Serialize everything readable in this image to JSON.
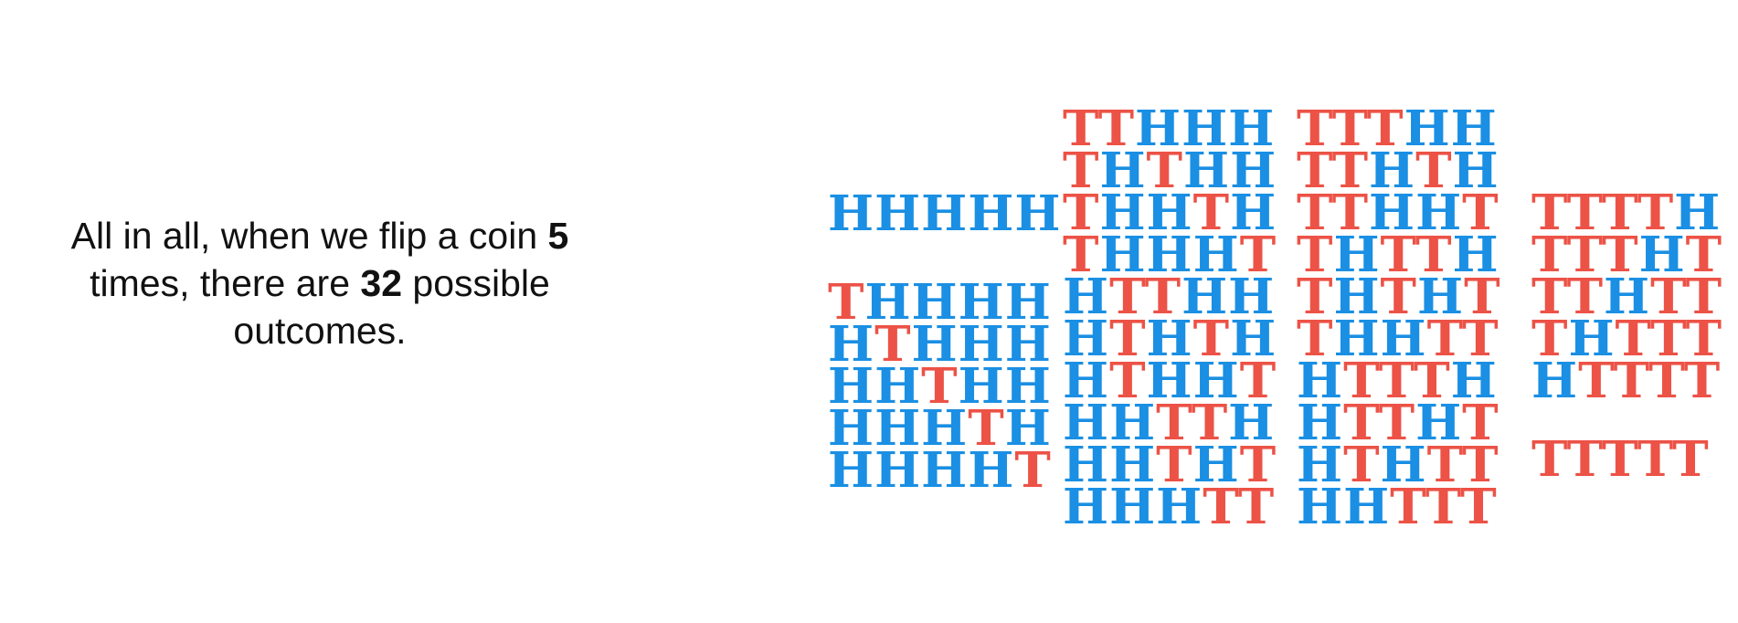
{
  "caption": {
    "line1_before": "All in all, when we flip a coin ",
    "line1_bold": "5",
    "line2_before": "times, there are ",
    "line2_bold": "32",
    "line2_after": " possible",
    "line3": "outcomes."
  },
  "colors": {
    "heads": "#1a8fe3",
    "tails": "#ec5246"
  },
  "groups": [
    {
      "name": "zero-tails",
      "outcomes": [
        "HHHHH"
      ]
    },
    {
      "name": "one-tail",
      "outcomes": [
        "THHHH",
        "HTHHH",
        "HHTHH",
        "HHHTH",
        "HHHHT"
      ]
    },
    {
      "name": "two-tails",
      "outcomes": [
        "TTHHH",
        "THTHH",
        "THHTH",
        "THHHT",
        "HTTHH",
        "HTHTH",
        "HTHHT",
        "HHTTH",
        "HHTHT",
        "HHHTT"
      ]
    },
    {
      "name": "three-tails",
      "outcomes": [
        "TTTHH",
        "TTHTH",
        "TTHHT",
        "THTTH",
        "THTHT",
        "THHTT",
        "HTTTH",
        "HTTHT",
        "HTHTT",
        "HHTTT"
      ]
    },
    {
      "name": "four-tails",
      "outcomes": [
        "TTTTH",
        "TTTHT",
        "TTHTT",
        "THTTT",
        "HTTTT"
      ]
    },
    {
      "name": "five-tails",
      "outcomes": [
        "TTTTT"
      ]
    }
  ]
}
